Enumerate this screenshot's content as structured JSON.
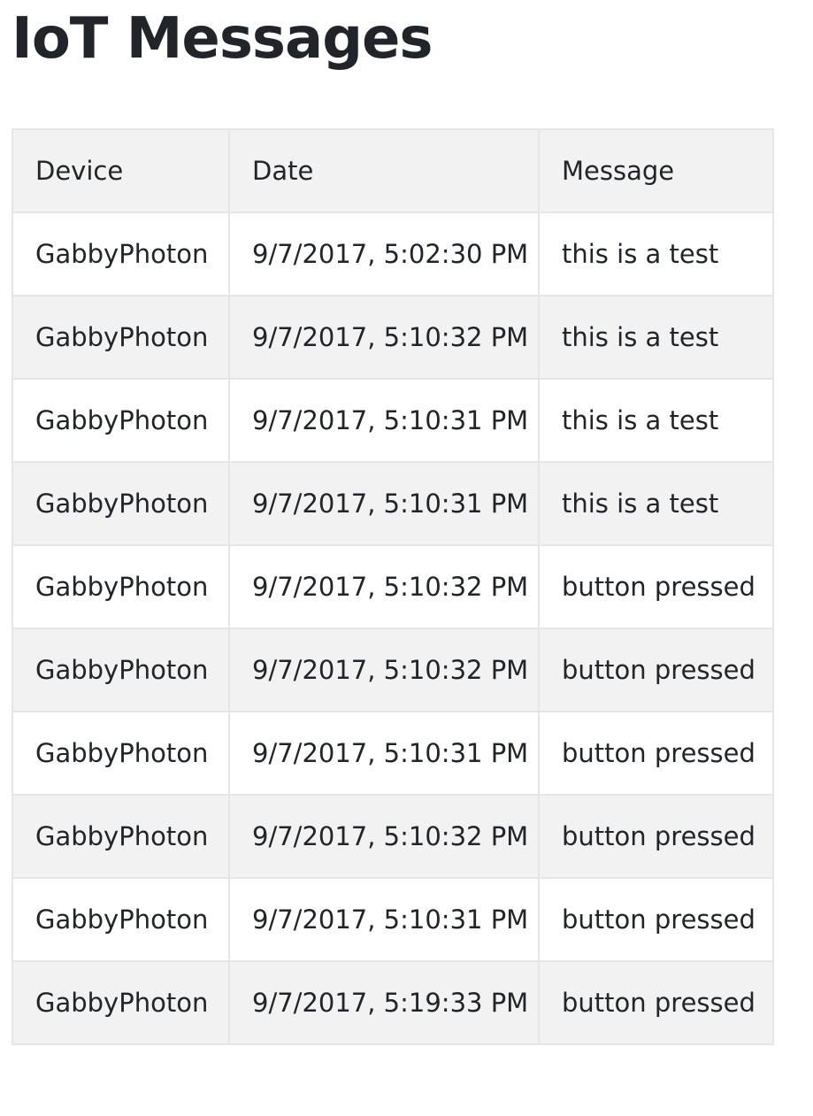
{
  "page": {
    "title": "IoT Messages"
  },
  "table": {
    "headers": {
      "device": "Device",
      "date": "Date",
      "message": "Message"
    },
    "rows": [
      {
        "device": "GabbyPhoton",
        "date": "9/7/2017, 5:02:30 PM",
        "message": "this is a test"
      },
      {
        "device": "GabbyPhoton",
        "date": "9/7/2017, 5:10:32 PM",
        "message": "this is a test"
      },
      {
        "device": "GabbyPhoton",
        "date": "9/7/2017, 5:10:31 PM",
        "message": "this is a test"
      },
      {
        "device": "GabbyPhoton",
        "date": "9/7/2017, 5:10:31 PM",
        "message": "this is a test"
      },
      {
        "device": "GabbyPhoton",
        "date": "9/7/2017, 5:10:32 PM",
        "message": "button pressed"
      },
      {
        "device": "GabbyPhoton",
        "date": "9/7/2017, 5:10:32 PM",
        "message": "button pressed"
      },
      {
        "device": "GabbyPhoton",
        "date": "9/7/2017, 5:10:31 PM",
        "message": "button pressed"
      },
      {
        "device": "GabbyPhoton",
        "date": "9/7/2017, 5:10:32 PM",
        "message": "button pressed"
      },
      {
        "device": "GabbyPhoton",
        "date": "9/7/2017, 5:10:31 PM",
        "message": "button pressed"
      },
      {
        "device": "GabbyPhoton",
        "date": "9/7/2017, 5:19:33 PM",
        "message": "button pressed"
      }
    ]
  },
  "colors": {
    "text": "#212529",
    "header_background": "#f2f2f2",
    "stripe_background": "#f2f2f2",
    "border": "#e6e6e6"
  }
}
